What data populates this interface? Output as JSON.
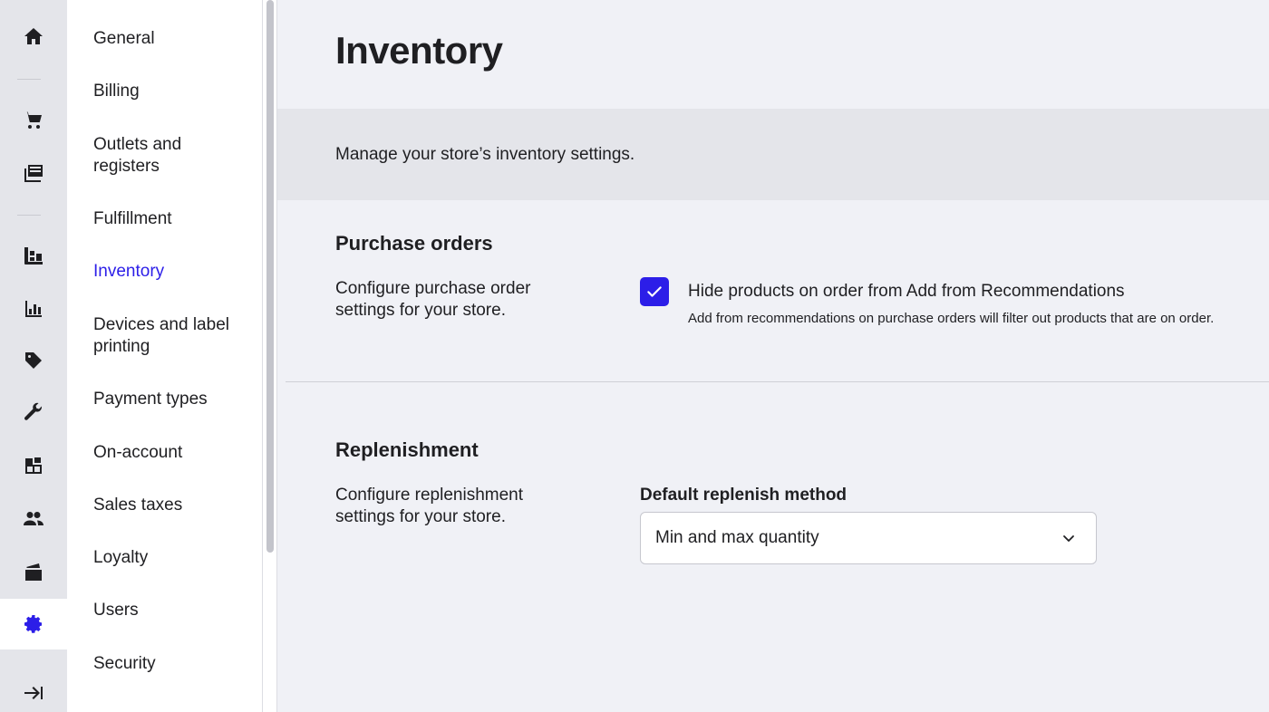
{
  "rail": {
    "items": [
      {
        "icon": "home-icon"
      },
      {
        "icon": "cart-icon"
      },
      {
        "icon": "catalog-icon"
      },
      {
        "icon": "inventory-cart-icon"
      },
      {
        "icon": "reports-icon"
      },
      {
        "icon": "tag-icon"
      },
      {
        "icon": "wrench-icon"
      },
      {
        "icon": "boxes-icon"
      },
      {
        "icon": "customers-icon"
      },
      {
        "icon": "wallet-icon"
      },
      {
        "icon": "gear-icon",
        "active": true
      },
      {
        "icon": "expand-icon"
      }
    ]
  },
  "settings_nav": {
    "items": [
      {
        "label": "General"
      },
      {
        "label": "Billing"
      },
      {
        "label": "Outlets and registers"
      },
      {
        "label": "Fulfillment"
      },
      {
        "label": "Inventory",
        "active": true
      },
      {
        "label": "Devices and label printing"
      },
      {
        "label": "Payment types"
      },
      {
        "label": "On-account"
      },
      {
        "label": "Sales taxes"
      },
      {
        "label": "Loyalty"
      },
      {
        "label": "Users"
      },
      {
        "label": "Security"
      }
    ]
  },
  "page": {
    "title": "Inventory",
    "description": "Manage your store’s inventory settings."
  },
  "purchase_orders": {
    "title": "Purchase orders",
    "description": "Configure purchase order settings for your store.",
    "checkbox_label": "Hide products on order from Add from Recommendations",
    "checkbox_help": "Add from recommendations on purchase orders will filter out products that are on order.",
    "checked": true
  },
  "replenishment": {
    "title": "Replenishment",
    "description": "Configure replenishment settings for your store.",
    "field_label": "Default replenish method",
    "selected_value": "Min and max quantity"
  },
  "colors": {
    "accent": "#2c1ee8",
    "background": "#f0f1f6",
    "banner": "#e4e5ea"
  }
}
